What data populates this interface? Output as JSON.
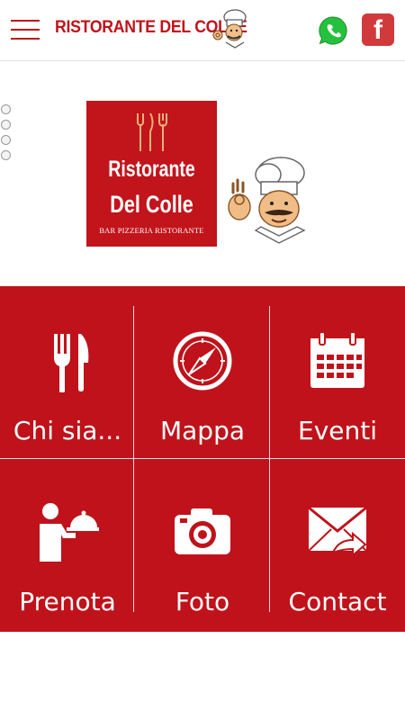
{
  "header": {
    "brand_title": "RISTORANTE DEL COLLE",
    "icons": {
      "menu": "hamburger-menu-icon",
      "chef": "chef-mascot-icon",
      "whatsapp": "whatsapp-icon",
      "facebook": "facebook-icon",
      "facebook_glyph": "f"
    }
  },
  "slider": {
    "dot_count": 4
  },
  "logo": {
    "line1": "Ristorante",
    "line2": "Del Colle",
    "subtitle": "BAR PIZZERIA RISTORANTE"
  },
  "menu": {
    "items": [
      {
        "label": "Chi sia...",
        "icon": "cutlery-icon"
      },
      {
        "label": "Mappa",
        "icon": "compass-icon"
      },
      {
        "label": "Eventi",
        "icon": "calendar-icon"
      },
      {
        "label": "Prenota",
        "icon": "waiter-cloche-icon"
      },
      {
        "label": "Foto",
        "icon": "camera-icon"
      },
      {
        "label": "Contact",
        "icon": "envelope-icon"
      }
    ]
  },
  "colors": {
    "brand_red": "#c0121a",
    "facebook_red": "#d13a3a",
    "whatsapp_green": "#25c13e",
    "white": "#ffffff"
  }
}
